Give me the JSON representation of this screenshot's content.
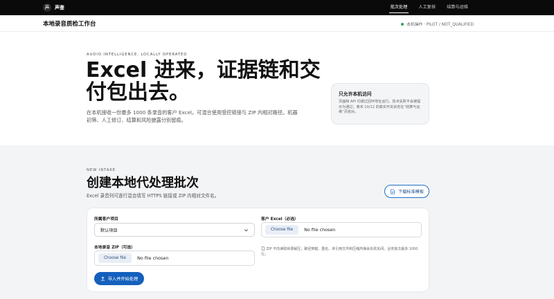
{
  "brand": {
    "name": "声鉴",
    "logo_glyph": "声",
    "logo_icon": "logo-icon"
  },
  "nav": [
    {
      "label": "批次处理",
      "active": true
    },
    {
      "label": "人工复核",
      "active": false
    },
    {
      "label": "结算与运维",
      "active": false
    }
  ],
  "app_title": "本地录音质检工作台",
  "status": {
    "text": "本机操作 · PILOT / NOT_QUALIFIED",
    "color": "#2e9e5b"
  },
  "hero": {
    "eyebrow": "AUDIO INTELLIGENCE, LOCALLY OPERATED",
    "title": "Excel 进来，证据链和交付包出去。",
    "description": "在本机接收一份最多 1000 条录音的客户 Excel。可混合使用受控链接与 ZIP 内相对路径。机器初筛、人工修订、结算和风险披露分别留痕。"
  },
  "notice": {
    "title": "只允许本机访问",
    "body": "页面和 API 均通过回环地址运行。技术失败不会被提示为通过；离末 10/12 的真实开关状态在“结算与运维”页核对。"
  },
  "intake": {
    "eyebrow": "NEW INTAKE",
    "title": "创建本地代处理批次",
    "subtitle": "Excel 录音列可逐行混合填写 HTTPS 链接或 ZIP 内相对文件名。",
    "download_label": "下载标准模板",
    "download_icon": "document-icon"
  },
  "form": {
    "project_label": "所属客户项目",
    "project_value": "默认项目",
    "excel_label": "客户 Excel（必选）",
    "zip_label": "本地录音 ZIP（可选）",
    "file_button": "Choose file",
    "file_none": "No file chosen",
    "zip_hint": "ZIP 不向读取目录解压；路径穿越、重名、未引用文件和压缩炸弹会失败关闭。业务批次最多 1000 行。",
    "hint_icon": "file-icon",
    "submit_label": "导入并开始处理",
    "submit_icon": "upload-icon"
  },
  "colors": {
    "accent": "#1560bd",
    "topbar": "#0a0a0a",
    "section_bg": "#f3f4f6"
  }
}
